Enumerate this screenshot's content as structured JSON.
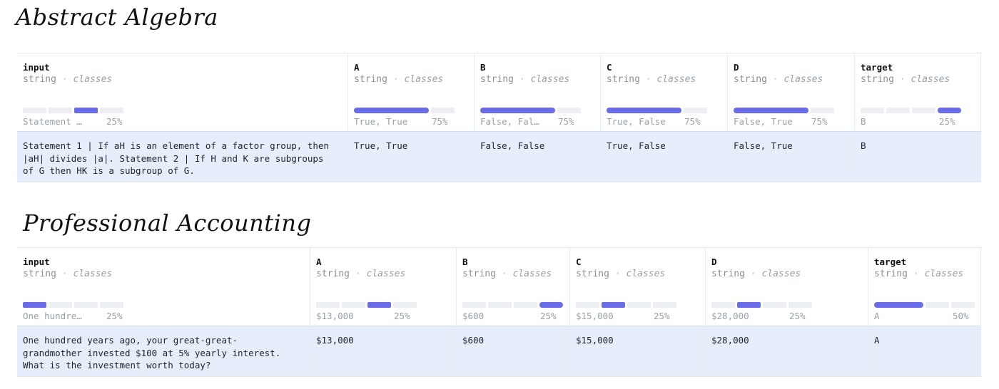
{
  "sections": [
    {
      "title": "Abstract Algebra",
      "columns": [
        {
          "name": "input",
          "type": "string",
          "kind": "classes",
          "summary": "Statement …",
          "pct": "25%",
          "fill": 0.25
        },
        {
          "name": "A",
          "type": "string",
          "kind": "classes",
          "summary": "True, True",
          "pct": "75%",
          "fill": 0.75
        },
        {
          "name": "B",
          "type": "string",
          "kind": "classes",
          "summary": "False, Fal…",
          "pct": "75%",
          "fill": 0.75
        },
        {
          "name": "C",
          "type": "string",
          "kind": "classes",
          "summary": "True, False",
          "pct": "75%",
          "fill": 0.75
        },
        {
          "name": "D",
          "type": "string",
          "kind": "classes",
          "summary": "False, True",
          "pct": "75%",
          "fill": 0.75
        },
        {
          "name": "target",
          "type": "string",
          "kind": "classes",
          "summary": "B",
          "pct": "25%",
          "fill": 0.25
        }
      ],
      "row": [
        "Statement 1 | If aH is an element of a factor group, then\n|aH| divides |a|. Statement 2 | If H and K are subgroups\nof G then HK is a subgroup of G.",
        "True, True",
        "False, False",
        "True, False",
        "False, True",
        "B"
      ]
    },
    {
      "title": "Professional Accounting",
      "columns": [
        {
          "name": "input",
          "type": "string",
          "kind": "classes",
          "summary": "One hundre…",
          "pct": "25%",
          "fill": 0.25
        },
        {
          "name": "A",
          "type": "string",
          "kind": "classes",
          "summary": "$13,000",
          "pct": "25%",
          "fill": 0.25
        },
        {
          "name": "B",
          "type": "string",
          "kind": "classes",
          "summary": "$600",
          "pct": "25%",
          "fill": 0.25
        },
        {
          "name": "C",
          "type": "string",
          "kind": "classes",
          "summary": "$15,000",
          "pct": "25%",
          "fill": 0.25
        },
        {
          "name": "D",
          "type": "string",
          "kind": "classes",
          "summary": "$28,000",
          "pct": "25%",
          "fill": 0.25
        },
        {
          "name": "target",
          "type": "string",
          "kind": "classes",
          "summary": "A",
          "pct": "50%",
          "fill": 0.5
        }
      ],
      "row": [
        "One hundred years ago, your great-great-\ngrandmother invested $100 at 5% yearly interest.\nWhat is the investment worth today?",
        "$13,000",
        "$600",
        "$15,000",
        "$28,000",
        "A"
      ]
    }
  ],
  "type_separator": "·",
  "colors": {
    "accent": "#6a6be9",
    "row_bg": "#e6eefb",
    "track": "#eceef1"
  }
}
